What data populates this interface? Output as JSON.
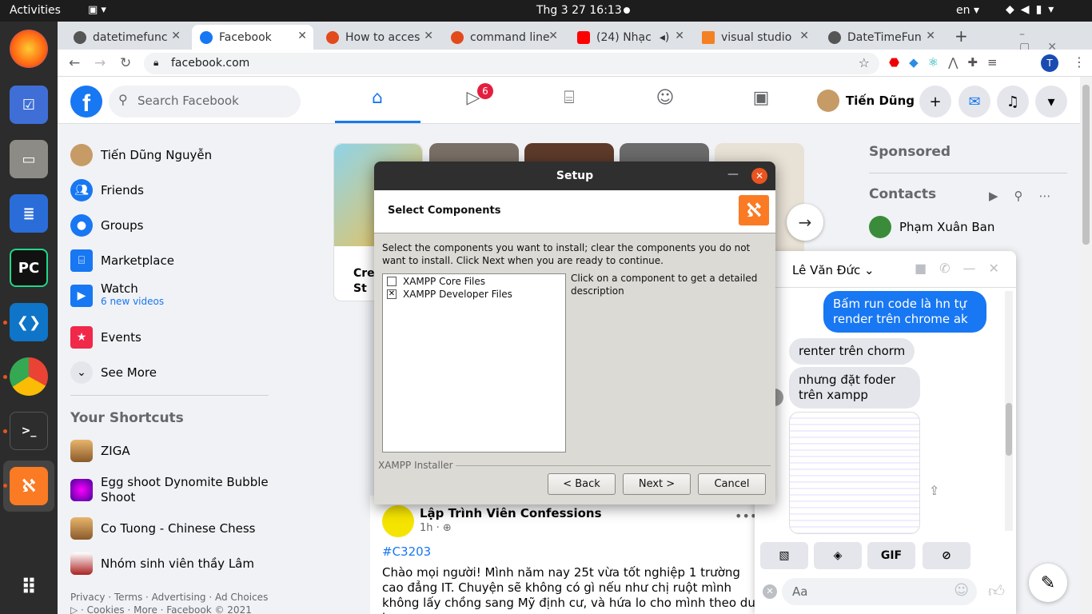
{
  "topbar": {
    "activities": "Activities",
    "clock": "Thg 3 27  16:13",
    "lang": "en"
  },
  "tabs": [
    {
      "label": "datetimefunc",
      "color": "#555555"
    },
    {
      "label": "Facebook",
      "color": "#1877f2"
    },
    {
      "label": "How to acces",
      "color": "#e24a1c"
    },
    {
      "label": "command line",
      "color": "#e24a1c"
    },
    {
      "label": "(24) Nhạc",
      "color": "#ff0000"
    },
    {
      "label": "visual studio",
      "color": "#f48024"
    },
    {
      "label": "DateTimeFun",
      "color": "#555555"
    }
  ],
  "address": {
    "url": "facebook.com",
    "profile_initial": "T"
  },
  "fb_header": {
    "search_placeholder": "Search Facebook",
    "watch_badge": "6",
    "profile_name": "Tiến Dũng"
  },
  "sidebar": {
    "items": [
      {
        "label": "Tiến Dũng Nguyễn"
      },
      {
        "label": "Friends"
      },
      {
        "label": "Groups"
      },
      {
        "label": "Marketplace"
      },
      {
        "label": "Watch",
        "sub": "6 new videos"
      },
      {
        "label": "Events"
      },
      {
        "label": "See More"
      }
    ],
    "shortcuts_title": "Your Shortcuts",
    "shortcuts": [
      {
        "label": "ZIGA"
      },
      {
        "label": "Egg shoot Dynomite Bubble Shoot"
      },
      {
        "label": "Co Tuong - Chinese Chess"
      },
      {
        "label": "Nhóm sinh viên thầy Lâm"
      }
    ],
    "footer": "Privacy · Terms · Advertising · Ad Choices ▷ · Cookies · More · Facebook © 2021"
  },
  "stories": {
    "create_label": "Cre St"
  },
  "post": {
    "author": "Lập Trình Viên Confessions",
    "time": "1h",
    "hashtag": "#C3203",
    "text": "Chào mọi người! Mình năm nay 25t vừa tốt nghiệp 1 trường cao đẳng IT. Chuyện sẽ không có gì nếu như chị ruột mình không lấy chồng sang Mỹ định cư, và hứa lo cho mình theo du học."
  },
  "right": {
    "sponsored": "Sponsored",
    "contacts": "Contacts",
    "contact_1": "Phạm Xuân Ban"
  },
  "chat": {
    "name": "Lê Văn Đức",
    "messages": [
      {
        "from": "me",
        "text": "Bấm run code là hn tự render trên chrome ak"
      },
      {
        "from": "them",
        "text": "renter trên chorm"
      },
      {
        "from": "them",
        "text": "nhưng đặt foder trên xampp"
      }
    ],
    "input_placeholder": "Aa",
    "gif_label": "GIF"
  },
  "dialog": {
    "title": "Setup",
    "heading": "Select Components",
    "description": "Select the components you want to install; clear the components you do not want to install. Click Next when you are ready to continue.",
    "components": [
      {
        "label": "XAMPP Core Files",
        "checked": false
      },
      {
        "label": "XAMPP Developer Files",
        "checked": true
      }
    ],
    "component_hint": "Click on a component to get a detailed description",
    "installer_label": "XAMPP Installer",
    "back": "< Back",
    "next": "Next >",
    "cancel": "Cancel"
  }
}
